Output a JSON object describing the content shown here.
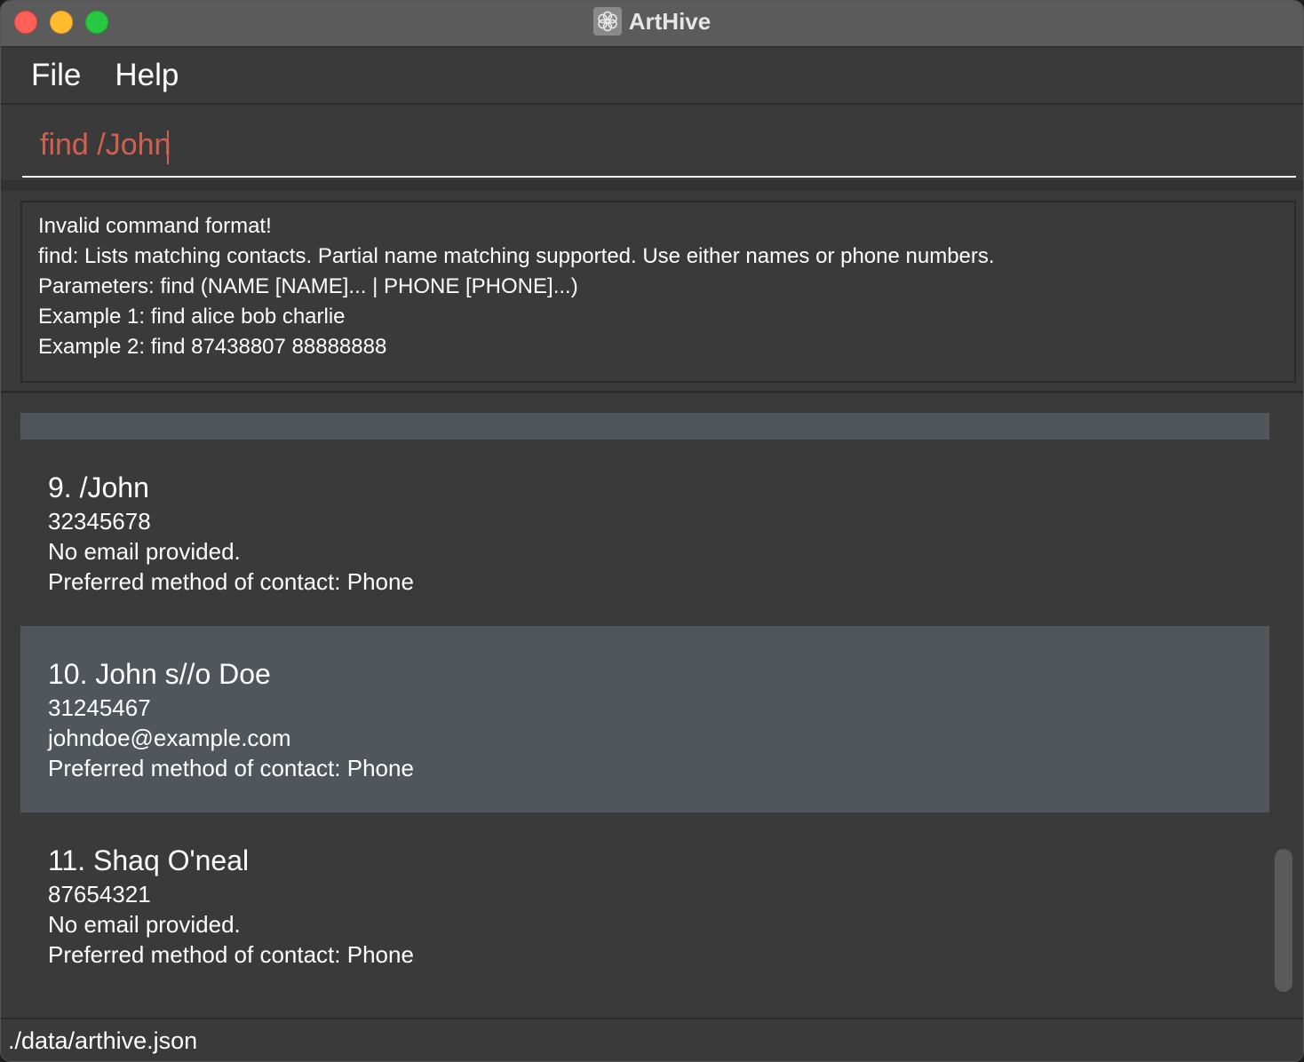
{
  "window": {
    "title": "ArtHive",
    "app_icon": "flower-icon"
  },
  "menu": {
    "items": [
      {
        "label": "File"
      },
      {
        "label": "Help"
      }
    ]
  },
  "command": {
    "value": "find /John",
    "text_color": "#d0604f"
  },
  "result": {
    "lines": [
      "Invalid command format!",
      "find: Lists matching contacts. Partial name matching supported. Use either names or phone numbers.",
      "Parameters: find (NAME [NAME]... | PHONE [PHONE]...)",
      "Example 1: find alice bob charlie",
      "Example 2: find 87438807 88888888"
    ]
  },
  "contacts": [
    {
      "name": "9. /John",
      "phone": "32345678",
      "email": "No email provided.",
      "preferred": "Preferred method of contact: Phone",
      "selected": false
    },
    {
      "name": "10. John s//o Doe",
      "phone": "31245467",
      "email": "johndoe@example.com",
      "preferred": "Preferred method of contact: Phone",
      "selected": true
    },
    {
      "name": "11. Shaq O'neal",
      "phone": "87654321",
      "email": "No email provided.",
      "preferred": "Preferred method of contact: Phone",
      "selected": false
    }
  ],
  "status": {
    "file_path": "./data/arthive.json"
  },
  "colors": {
    "window_bg": "#3a3a3b",
    "titlebar_bg": "#5b5b5b",
    "selected_card": "#50565b",
    "command_text": "#d0604f"
  }
}
